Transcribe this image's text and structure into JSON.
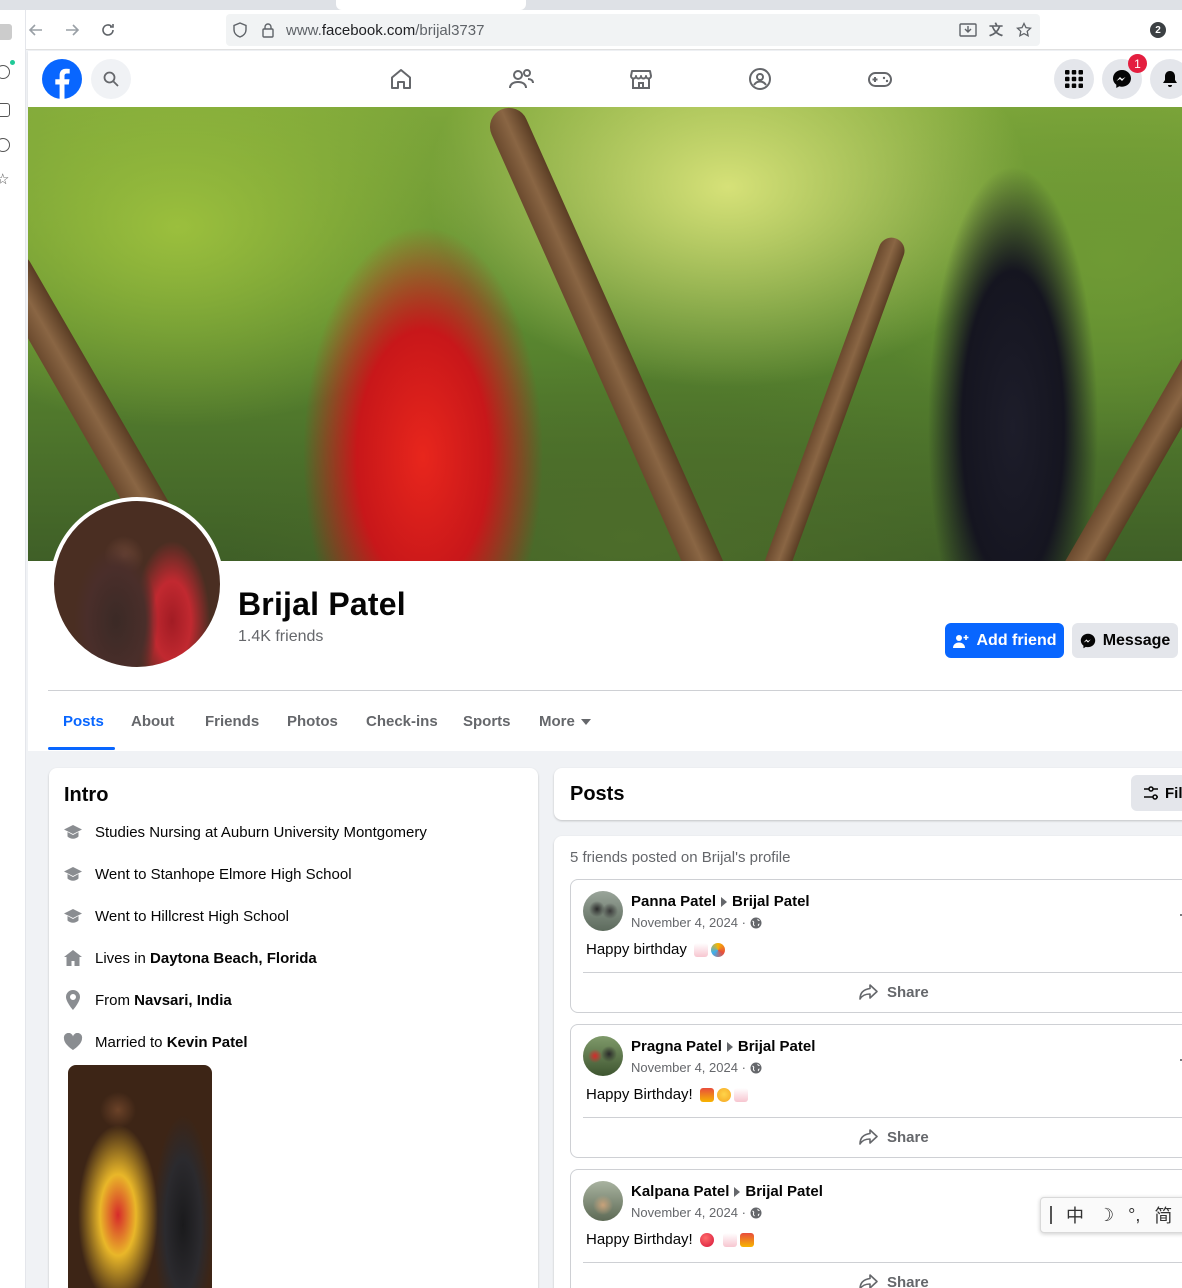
{
  "browser": {
    "url_prefix": "www.",
    "url_domain": "facebook.com",
    "url_path": "/brijal3737",
    "profile_badge": "2"
  },
  "fb": {
    "notification_count": "1",
    "brand_color": "#0866ff"
  },
  "profile": {
    "name": "Brijal Patel",
    "friends": "1.4K friends",
    "add_friend_label": "Add friend",
    "message_label": "Message"
  },
  "tabs": [
    "Posts",
    "About",
    "Friends",
    "Photos",
    "Check-ins",
    "Sports",
    "More"
  ],
  "intro": {
    "title": "Intro",
    "rows": [
      {
        "icon": "graduation-cap-icon",
        "prefix": "Studies Nursing at Auburn University Montgomery",
        "bold": ""
      },
      {
        "icon": "graduation-cap-icon",
        "prefix": "Went to Stanhope Elmore High School",
        "bold": ""
      },
      {
        "icon": "graduation-cap-icon",
        "prefix": "Went to Hillcrest High School",
        "bold": ""
      },
      {
        "icon": "home-icon",
        "prefix": "Lives in ",
        "bold": "Daytona Beach, Florida"
      },
      {
        "icon": "location-pin-icon",
        "prefix": "From ",
        "bold": "Navsari, India"
      },
      {
        "icon": "heart-icon",
        "prefix": "Married to ",
        "bold": "Kevin Patel"
      }
    ]
  },
  "posts_section": {
    "title": "Posts",
    "filter_label": "Filt",
    "friends_posted": "5 friends posted on Brijal's profile"
  },
  "posts": [
    {
      "author": "Panna Patel",
      "target": "Brijal Patel",
      "date": "November 4, 2024 ·",
      "text": "Happy birthday",
      "share": "Share"
    },
    {
      "author": "Pragna Patel",
      "target": "Brijal Patel",
      "date": "November 4, 2024 ·",
      "text": "Happy Birthday!",
      "share": "Share"
    },
    {
      "author": "Kalpana Patel",
      "target": "Brijal Patel",
      "date": "November 4, 2024 ·",
      "text": "Happy Birthday!",
      "share": "Share"
    }
  ],
  "ime": {
    "lang": "中",
    "punct": "°,",
    "script": "简"
  }
}
